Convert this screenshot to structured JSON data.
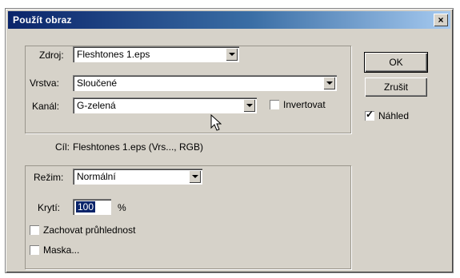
{
  "window": {
    "title": "Použít obraz",
    "close_glyph": "×"
  },
  "source_group": {
    "zdroj_label": "Zdroj:",
    "zdroj_value": "Fleshtones 1.eps",
    "vrstva_label": "Vrstva:",
    "vrstva_value": "Sloučené",
    "kanal_label": "Kanál:",
    "kanal_value": "G-zelená",
    "invert_label": "Invertovat",
    "invert_checked": false
  },
  "target": {
    "label": "Cíl:",
    "value": "Fleshtones 1.eps (Vrs..., RGB)"
  },
  "blend_group": {
    "rezim_label": "Režim:",
    "rezim_value": "Normální",
    "kryti_label": "Krytí:",
    "kryti_value": "100",
    "kryti_unit": "%",
    "preserve_label": "Zachovat průhlednost",
    "preserve_checked": false,
    "mask_label": "Maska...",
    "mask_checked": false
  },
  "buttons": {
    "ok": "OK",
    "cancel": "Zrušit"
  },
  "preview": {
    "label": "Náhled",
    "checked": true
  },
  "colors": {
    "titlebar_start": "#0a246a",
    "titlebar_end": "#a6caf0",
    "dialog_bg": "#d6d2c9"
  }
}
